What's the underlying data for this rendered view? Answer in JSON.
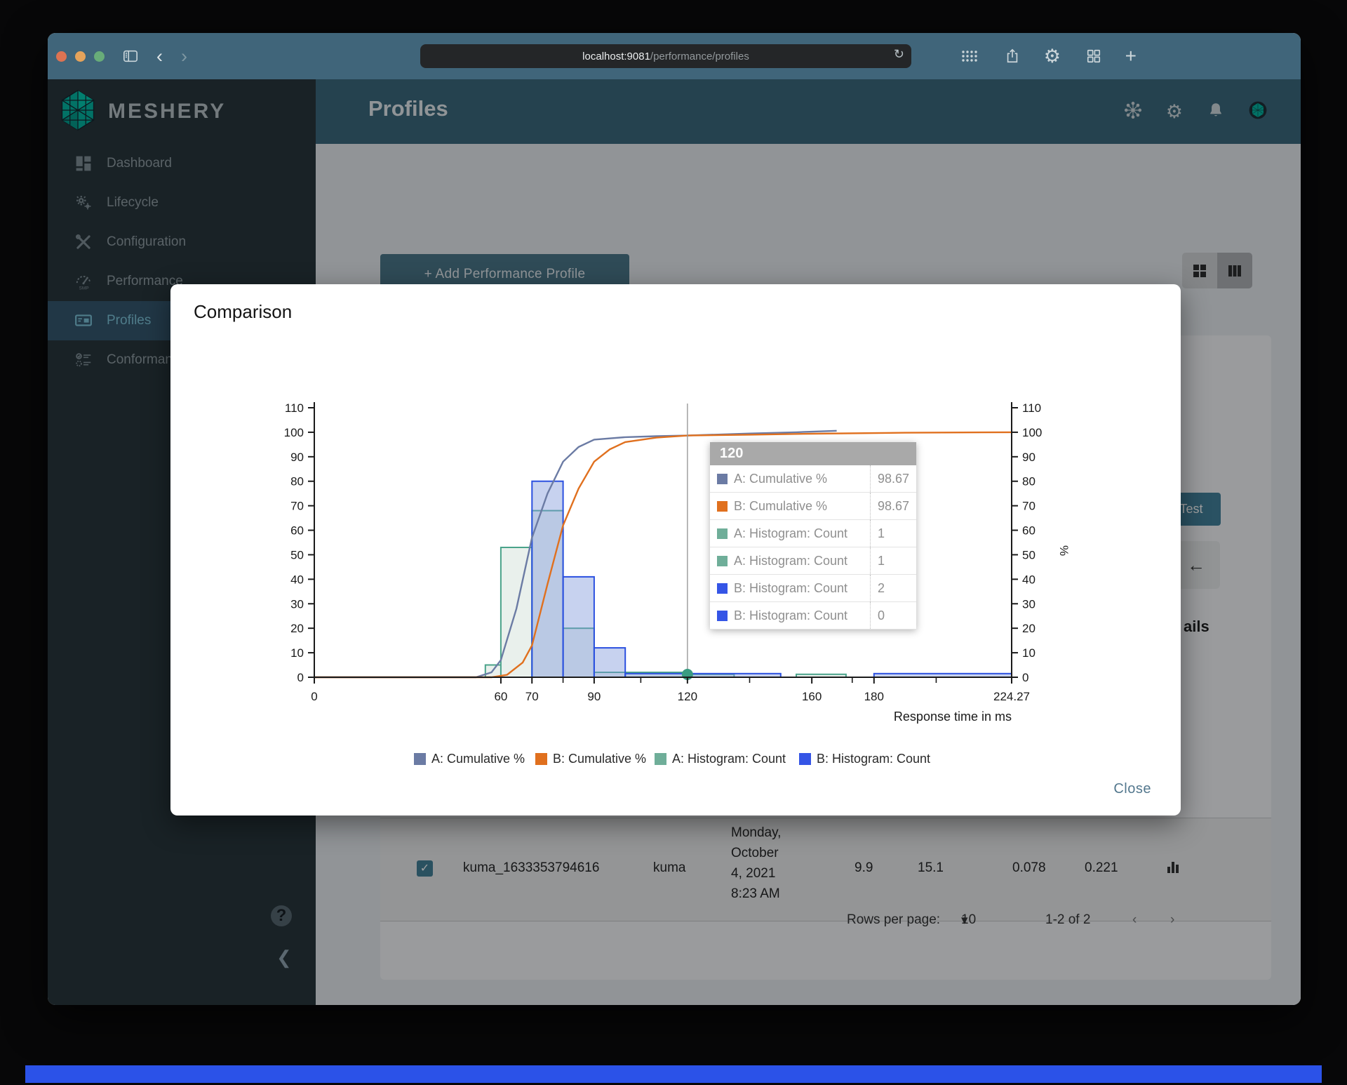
{
  "browser": {
    "url_host": "localhost:9081",
    "url_path": "/performance/profiles"
  },
  "brand": {
    "name": "MESHERY"
  },
  "app_header": {
    "title": "Profiles"
  },
  "sidebar": {
    "items": [
      {
        "id": "dashboard",
        "label": "Dashboard",
        "active": false
      },
      {
        "id": "lifecycle",
        "label": "Lifecycle",
        "active": false
      },
      {
        "id": "configuration",
        "label": "Configuration",
        "active": false
      },
      {
        "id": "performance",
        "label": "Performance",
        "active": false
      },
      {
        "id": "profiles",
        "label": "Profiles",
        "active": true
      },
      {
        "id": "conformance",
        "label": "Conformance",
        "active": false
      }
    ],
    "help_label": "?"
  },
  "content": {
    "add_profile_button": "Add Performance Profile",
    "test_button": "Test",
    "details_fragment": "ails",
    "table_row": {
      "name": "kuma_1633353794616",
      "mesh": "kuma",
      "date_lines": [
        "Monday,",
        "October",
        "4, 2021",
        "8:23 AM"
      ],
      "qps": "9.9",
      "duration": "15.1",
      "p50": "0.078",
      "p99": "0.221"
    },
    "pagination": {
      "label": "Rows per page:",
      "per_page": "10",
      "range": "1-2 of 2"
    }
  },
  "modal": {
    "title": "Comparison",
    "close_label": "Close"
  },
  "chart_data": {
    "type": "combo-histogram-cumulative",
    "xlabel": "Response time in ms",
    "right_ylabel": "%",
    "xlim": [
      0,
      224.27
    ],
    "ylim": [
      0,
      110
    ],
    "x_ticks": [
      0,
      60,
      70,
      90,
      120,
      160,
      180,
      224.27
    ],
    "x_minor_ticks": [
      80,
      105,
      140,
      173,
      200
    ],
    "y_tick_step": 10,
    "legend": [
      "A: Cumulative %",
      "B: Cumulative %",
      "A: Histogram: Count",
      "B: Histogram: Count"
    ],
    "series": [
      {
        "name": "A: Cumulative %",
        "type": "line",
        "color": "#6b7ba4",
        "points": [
          [
            0,
            0
          ],
          [
            52,
            0
          ],
          [
            57,
            2
          ],
          [
            60,
            7
          ],
          [
            65,
            28
          ],
          [
            70,
            57
          ],
          [
            75,
            75
          ],
          [
            80,
            88
          ],
          [
            85,
            94
          ],
          [
            90,
            97
          ],
          [
            100,
            98
          ],
          [
            110,
            98.4
          ],
          [
            120,
            98.67
          ],
          [
            140,
            99.5
          ],
          [
            155,
            100
          ],
          [
            168,
            100.6
          ]
        ]
      },
      {
        "name": "B: Cumulative %",
        "type": "line",
        "color": "#e0701e",
        "points": [
          [
            0,
            0
          ],
          [
            57,
            0
          ],
          [
            62,
            1
          ],
          [
            67,
            6
          ],
          [
            70,
            13
          ],
          [
            75,
            38
          ],
          [
            80,
            62
          ],
          [
            85,
            77
          ],
          [
            90,
            88
          ],
          [
            95,
            93
          ],
          [
            100,
            96
          ],
          [
            110,
            97.8
          ],
          [
            120,
            98.67
          ],
          [
            140,
            99
          ],
          [
            160,
            99.4
          ],
          [
            190,
            99.8
          ],
          [
            224.27,
            100
          ]
        ]
      },
      {
        "name": "A: Histogram: Count",
        "type": "bar",
        "stroke": "#4aa38a",
        "fill": "#e9f0ec",
        "bins": [
          [
            55,
            60,
            5
          ],
          [
            60,
            70,
            53
          ],
          [
            70,
            80,
            68
          ],
          [
            80,
            90,
            20
          ],
          [
            90,
            100,
            2
          ],
          [
            100,
            120,
            2
          ],
          [
            120,
            135,
            1.2
          ],
          [
            155,
            171,
            1.2
          ]
        ]
      },
      {
        "name": "B: Histogram: Count",
        "type": "bar",
        "stroke": "#2b50e0",
        "fill": "rgba(122,148,216,0.42)",
        "bins": [
          [
            70,
            80,
            80
          ],
          [
            80,
            90,
            41
          ],
          [
            90,
            100,
            12
          ],
          [
            100,
            150,
            1.5
          ],
          [
            180,
            224.27,
            1.5
          ]
        ]
      }
    ],
    "hover": {
      "x": 120,
      "dot_color": "#3a9c82",
      "title": "120",
      "rows": [
        {
          "color": "#6b7ba4",
          "label": "A: Cumulative %",
          "value": "98.67"
        },
        {
          "color": "#e0701e",
          "label": "B: Cumulative %",
          "value": "98.67"
        },
        {
          "color": "#6fae99",
          "label": "A: Histogram: Count",
          "value": "1"
        },
        {
          "color": "#6fae99",
          "label": "A: Histogram: Count",
          "value": "1"
        },
        {
          "color": "#3555e6",
          "label": "B: Histogram: Count",
          "value": "2"
        },
        {
          "color": "#3555e6",
          "label": "B: Histogram: Count",
          "value": "0"
        }
      ]
    }
  }
}
